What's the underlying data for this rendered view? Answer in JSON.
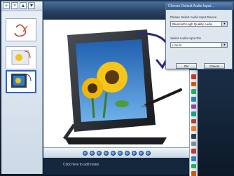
{
  "dialog": {
    "title": "Choose Default Audio Input...",
    "device_label": "Please Select Audio Input Device",
    "device_value": "Bluetooth High Quality Audio",
    "pin_label": "Select Audio Input Pin",
    "pin_value": "Line In",
    "ok_label": "OK",
    "cancel_label": "Cancel"
  },
  "status": {
    "text": "Click here to add notes"
  },
  "icons": {
    "nav_dot": "page-nav-icon",
    "tool_colors": [
      "#c0392b",
      "#d35400",
      "#27ae60",
      "#2980b9",
      "#8e44ad",
      "#16a085",
      "#c0392b",
      "#e67e22",
      "#2c3e50",
      "#7f8c8d",
      "#c0392b",
      "#2980b9",
      "#27ae60",
      "#d35400"
    ]
  },
  "colors": {
    "accent": "#2b66c9",
    "app_background": "#16283e"
  }
}
